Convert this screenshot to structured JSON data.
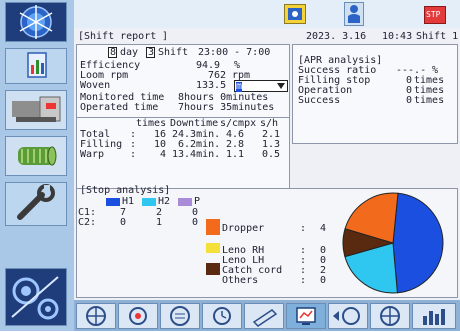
{
  "header": {
    "title": "Shift report",
    "date": "2023. 3.16",
    "time": "10:43",
    "shift": "Shift 1",
    "stop_label": "STP"
  },
  "report": {
    "day_count": "8",
    "day_label": "day",
    "shift_num": "3",
    "shift_label": "Shift",
    "shift_hours": "23:00 - 7:00",
    "rows": [
      {
        "label": "Efficiency",
        "value": "94.9",
        "unit": "%"
      },
      {
        "label": "Loom rpm",
        "value": "762",
        "unit": "rpm"
      },
      {
        "label": "Woven",
        "value": "133.5",
        "unit": "m"
      },
      {
        "label": "Monitored time",
        "value": "8hours 0minutes",
        "unit": ""
      },
      {
        "label": "Operated time",
        "value": "7hours 35minutes",
        "unit": ""
      }
    ],
    "stop_table": {
      "columns": [
        "times",
        "Downtime",
        "s/cmpx",
        "s/h"
      ],
      "rows": [
        {
          "label": "Total",
          "times": "16",
          "downtime": "24.3min.",
          "s_cmpx": "4.6",
          "s_h": "2.1"
        },
        {
          "label": "Filling",
          "times": "10",
          "downtime": "6.2min.",
          "s_cmpx": "2.8",
          "s_h": "1.3"
        },
        {
          "label": "Warp",
          "times": "4",
          "downtime": "13.4min.",
          "s_cmpx": "1.1",
          "s_h": "0.5"
        }
      ]
    }
  },
  "apr": {
    "title": "[APR analysis]",
    "rows": [
      {
        "label": "Success ratio",
        "value": "---.-",
        "unit": "%"
      },
      {
        "label": "Filling stop",
        "value": "0",
        "unit": "times"
      },
      {
        "label": "Operation",
        "value": "0",
        "unit": "times"
      },
      {
        "label": "Success",
        "value": "0",
        "unit": "times"
      }
    ]
  },
  "stop_analysis": {
    "title": "[Stop analysis]",
    "groups": [
      "H1",
      "H2",
      "P"
    ],
    "group_colors": [
      "#1a4fe0",
      "#2fc7f0",
      "#a98bd8"
    ],
    "c_rows": [
      {
        "label": "C1:",
        "values": [
          "7",
          "2",
          "0"
        ]
      },
      {
        "label": "C2:",
        "values": [
          "0",
          "1",
          "0"
        ]
      }
    ],
    "causes": [
      {
        "label": "Dropper",
        "value": "4",
        "color": "#f26b1d"
      },
      {
        "label": "Leno RH",
        "value": "0",
        "color": "#f4e03a"
      },
      {
        "label": "Leno LH",
        "value": "0",
        "color": ""
      },
      {
        "label": "Catch cord",
        "value": "2",
        "color": "#5a2a10"
      },
      {
        "label": "Others",
        "value": "0",
        "color": ""
      }
    ]
  },
  "pie": {
    "slices": [
      {
        "value": 0.47,
        "color": "#1a4fe0"
      },
      {
        "value": 0.22,
        "color": "#2fc7f0"
      },
      {
        "value": 0.09,
        "color": "#5a2a10"
      },
      {
        "value": 0.22,
        "color": "#f26b1d"
      }
    ]
  },
  "sidebar": {
    "items": [
      {
        "icon": "network-icon"
      },
      {
        "icon": "report-icon"
      },
      {
        "icon": "loom-icon"
      },
      {
        "icon": "fabric-roll-icon"
      },
      {
        "icon": "wrench-icon"
      },
      {
        "icon": "settings-gear-icon"
      }
    ]
  },
  "bottom_tabs": [
    {
      "icon": "car-wheel-icon"
    },
    {
      "icon": "bobbin-icon"
    },
    {
      "icon": "weave-icon"
    },
    {
      "icon": "timer-icon"
    },
    {
      "icon": "pen-icon"
    },
    {
      "icon": "monitor-report-icon"
    },
    {
      "icon": "prev-wheel-icon"
    },
    {
      "icon": "wheel-icon"
    },
    {
      "icon": "bar-chart-icon"
    }
  ]
}
